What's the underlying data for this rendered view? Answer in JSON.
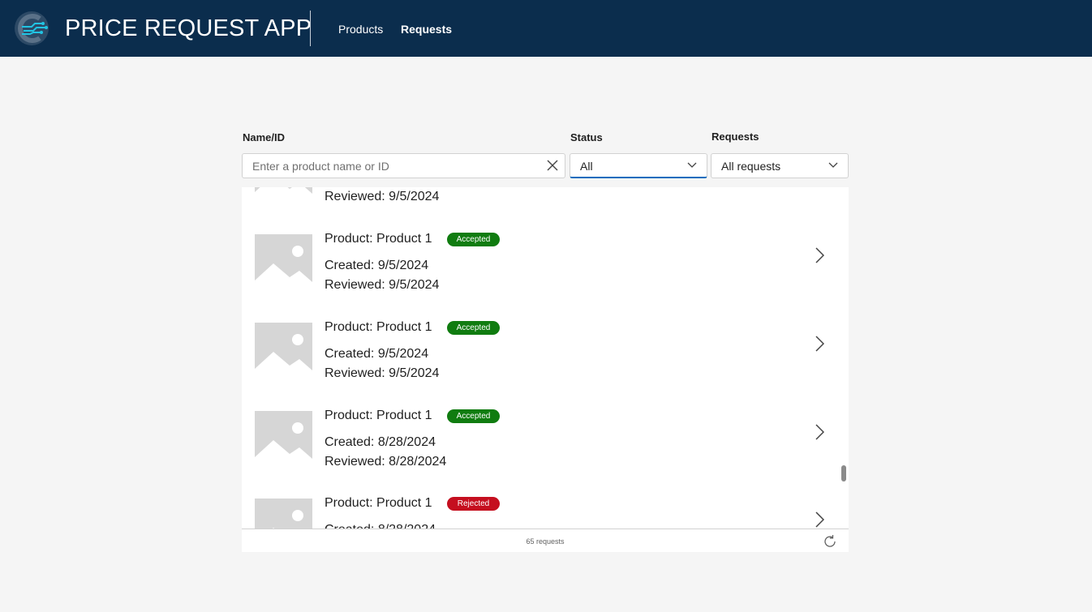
{
  "header": {
    "app_title": "PRICE REQUEST APP",
    "nav": [
      {
        "label": "Products",
        "active": false
      },
      {
        "label": "Requests",
        "active": true
      }
    ],
    "logo_icon": "circuit-c-logo-icon"
  },
  "filters": {
    "name_label": "Name/ID",
    "search_placeholder": "Enter a product name or ID",
    "search_value": "",
    "status_label": "Status",
    "status_value": "All",
    "requests_label": "Requests",
    "requests_value": "All requests"
  },
  "requests": [
    {
      "product": "",
      "status": "",
      "created": "",
      "reviewed": "Reviewed: 9/5/2024"
    },
    {
      "product": "Product: Product 1",
      "status": "Accepted",
      "created": "Created: 9/5/2024",
      "reviewed": "Reviewed: 9/5/2024"
    },
    {
      "product": "Product: Product 1",
      "status": "Accepted",
      "created": "Created: 9/5/2024",
      "reviewed": "Reviewed: 9/5/2024"
    },
    {
      "product": "Product: Product 1",
      "status": "Accepted",
      "created": "Created: 8/28/2024",
      "reviewed": "Reviewed: 8/28/2024"
    },
    {
      "product": "Product: Product 1",
      "status": "Rejected",
      "created": "Created: 8/28/2024",
      "reviewed": ""
    }
  ],
  "footer": {
    "count_text": "65 requests"
  },
  "colors": {
    "header_bg": "#0b2d4d",
    "accepted": "#107c10",
    "rejected": "#c50f1f",
    "focus_underline": "#0f6cbd"
  }
}
